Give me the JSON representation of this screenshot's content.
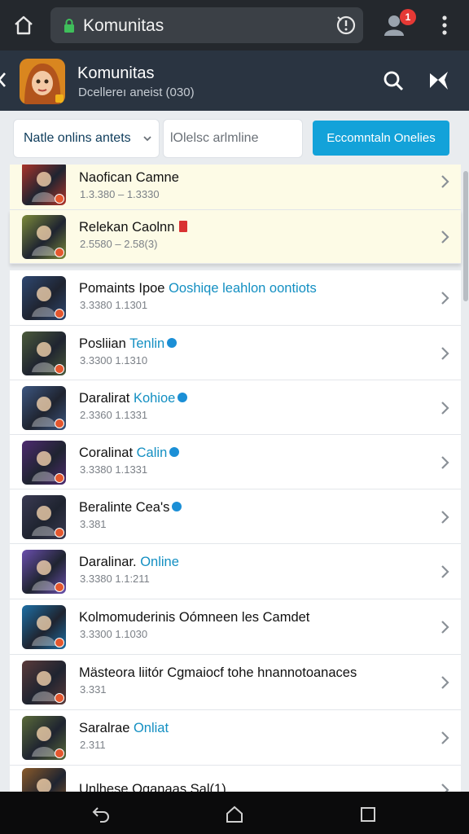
{
  "browser": {
    "url_text": "Komunitas",
    "notification_count": "1"
  },
  "header": {
    "title": "Komunitas",
    "subtitle": "Dcellereı aneist (030)"
  },
  "filters": {
    "select_value": "Natle onlins antets",
    "input_value": "lOlelsc arlmline",
    "button_label": "Eccomntaln Onelies"
  },
  "rows": [
    {
      "title": "Naofican Camne",
      "title_hl": "",
      "meta": "1.3.380  –  1.3330",
      "accent": "#b3352a"
    },
    {
      "title": "Relekan Caolnn",
      "title_hl": "",
      "meta": "2.5580  –  2.58(3)",
      "accent": "#7c8a3a"
    },
    {
      "title": "Pomaints Ipoe",
      "title_hl": "Ooshiqe leahlon oontiots",
      "meta": "3.3380  1.1301",
      "accent": "#2e4770"
    },
    {
      "title": "Posliian",
      "title_hl": "Tenlin",
      "meta": "3.3300  1.1310",
      "accent": "#4b5a3b"
    },
    {
      "title": "Daralirat",
      "title_hl": "Kohioe",
      "meta": "2.3360  1.1331",
      "accent": "#3c5680"
    },
    {
      "title": "Coralinat",
      "title_hl": "Calin",
      "meta": "3.3380  1.1331",
      "accent": "#4d2a70"
    },
    {
      "title": "Beralinte Cea's",
      "title_hl": "",
      "meta": "3.381",
      "accent": "#3a3a52"
    },
    {
      "title": "Daralinar.",
      "title_hl": "Online",
      "meta": "3.3380  1.1:211",
      "accent": "#6a4fae"
    },
    {
      "title": "Kolmomuderinis Oómneen les Camdet",
      "title_hl": "",
      "meta": "3.3300  1.1030",
      "accent": "#1d6fa5"
    },
    {
      "title": "Mästeora liitór Cgmaiocf tohe hnannotoanaces",
      "title_hl": "",
      "meta": "3.331",
      "accent": "#5a3a3a"
    },
    {
      "title": "Saralrae",
      "title_hl": "Onliat",
      "meta": "2.311",
      "accent": "#5a6a3a"
    },
    {
      "title": "Unlhese Oganaas Sal(1)",
      "title_hl": "",
      "meta": "",
      "accent": "#8a5a2a"
    }
  ],
  "icons": {
    "home": "home-icon",
    "lock": "lock-icon",
    "account": "account-icon",
    "menu": "more-vert-icon",
    "search": "search-icon",
    "share": "share-icon",
    "chevron": "chevron-right-icon"
  },
  "colors": {
    "accent": "#13a2d9",
    "header_bg": "#2a3441",
    "highlight_row": "#fdfbe6",
    "badge": "#e53935"
  }
}
